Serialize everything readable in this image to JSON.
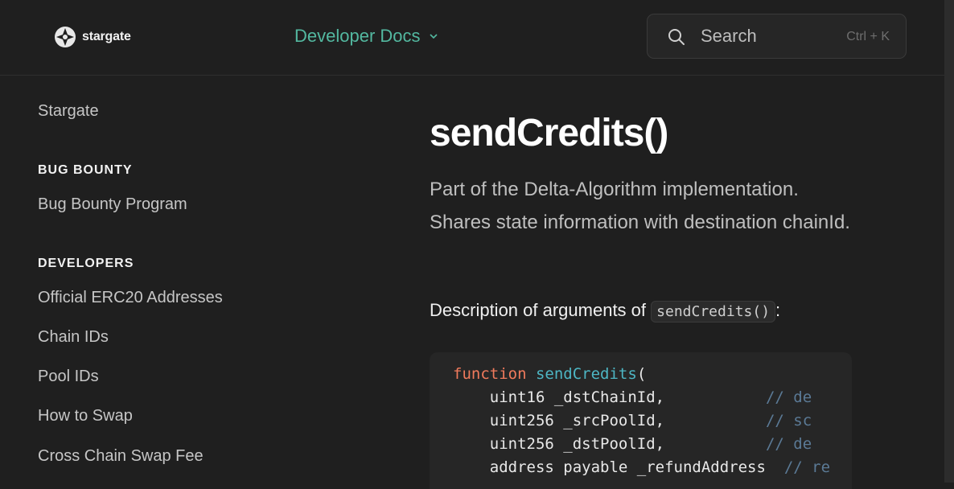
{
  "header": {
    "logo_text": "stargate",
    "docs_switcher": "Developer Docs",
    "search": {
      "label": "Search",
      "shortcut": "Ctrl + K"
    }
  },
  "sidebar": {
    "top_link": "Stargate",
    "sections": [
      {
        "heading": "BUG BOUNTY",
        "items": [
          "Bug Bounty Program"
        ]
      },
      {
        "heading": "DEVELOPERS",
        "items": [
          "Official ERC20 Addresses",
          "Chain IDs",
          "Pool IDs",
          "How to Swap",
          "Cross Chain Swap Fee"
        ]
      }
    ]
  },
  "content": {
    "title": "sendCredits()",
    "lead": "Part of the Delta-Algorithm implementation. Shares state information with destination chainId.",
    "args_prefix": "Description of arguments of",
    "args_code": "sendCredits()",
    "args_suffix": ":",
    "code": {
      "keyword": "function",
      "fn_name": "sendCredits",
      "open_paren": "(",
      "lines": [
        {
          "code": "    uint16 _dstChainId,           ",
          "comment": "// de"
        },
        {
          "code": "    uint256 _srcPoolId,           ",
          "comment": "// sc"
        },
        {
          "code": "    uint256 _dstPoolId,           ",
          "comment": "// de"
        },
        {
          "code": "    address payable _refundAddress  ",
          "comment": "// re"
        }
      ]
    }
  },
  "colors": {
    "background": "#1f1f1f",
    "accent": "#53b8a0",
    "keyword": "#f07a5c",
    "function": "#4db6c4",
    "comment": "#5b7a96"
  }
}
